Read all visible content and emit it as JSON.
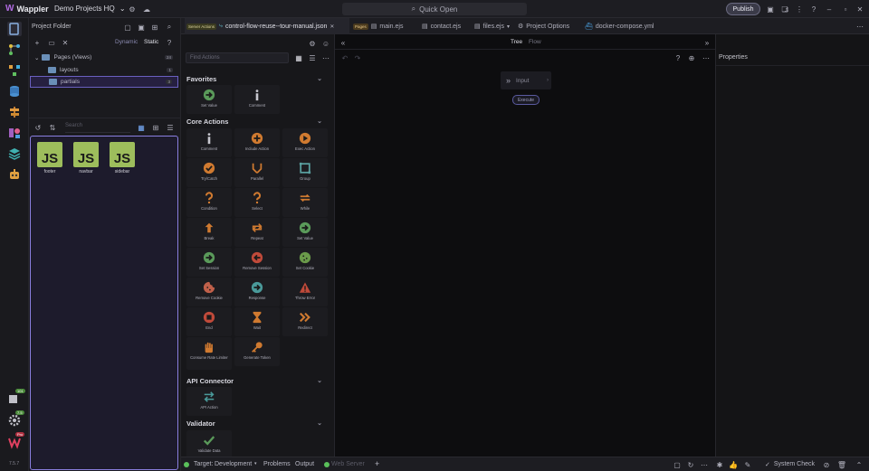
{
  "app": {
    "name": "Wappler",
    "version": "7.5.7"
  },
  "topbar": {
    "project": "Demo Projects HQ",
    "quick_open": "Quick Open",
    "publish": "Publish"
  },
  "rail": {
    "badges": {
      "b1": "101",
      "b2": "7.5",
      "b3": "Pro"
    }
  },
  "project_panel": {
    "title": "Project Folder",
    "toggle": {
      "dynamic": "Dynamic",
      "static": "Static"
    },
    "tree": [
      {
        "label": "Pages (Views)",
        "count": "24"
      },
      {
        "label": "layouts",
        "count": "1"
      },
      {
        "label": "partials",
        "count": "3"
      }
    ],
    "search_placeholder": "Search",
    "files": [
      "footer",
      "navbar",
      "sidebar"
    ],
    "file_icon_text": "JS"
  },
  "tabs": {
    "server_actions_tag": "Server Actions",
    "pages_tag": "Pages",
    "items": [
      {
        "label": "control-flow-reuse--tour-manual.json"
      },
      {
        "label": "main.ejs"
      },
      {
        "label": "contact.ejs"
      },
      {
        "label": "files.ejs"
      },
      {
        "label": "Project Options"
      },
      {
        "label": "docker-compose.yml"
      }
    ]
  },
  "actions_panel": {
    "find_placeholder": "Find Actions",
    "sections": {
      "favorites": "Favorites",
      "core": "Core Actions",
      "api": "API Connector",
      "validator": "Validator"
    },
    "favorites": [
      "Set Value",
      "Comment"
    ],
    "core": [
      "Comment",
      "Include Action",
      "Exec Action",
      "Try/Catch",
      "Parallel",
      "Group",
      "Condition",
      "Select",
      "While",
      "Break",
      "Repeat",
      "Set Value",
      "Set Session",
      "Remove Session",
      "Set Cookie",
      "Remove Cookie",
      "Response",
      "Throw Error",
      "End",
      "Wait",
      "Redirect",
      "Consume Rate Limiter",
      "Generate Token"
    ],
    "api": [
      "API Action"
    ],
    "validator": [
      "Validate Data"
    ]
  },
  "canvas": {
    "view_tree": "Tree",
    "view_flow": "Flow",
    "input_node": "Input",
    "execute": "Execute"
  },
  "properties": {
    "title": "Properties"
  },
  "status": {
    "target_label": "Target:",
    "target_value": "Development",
    "problems": "Problems",
    "output": "Output",
    "web_server": "Web Server",
    "system_check": "System Check"
  },
  "colors": {
    "accent": "#8a7fe0",
    "js_file": "#9dbd5c",
    "status_ok": "#5ac05a",
    "warning": "#d4a840"
  }
}
